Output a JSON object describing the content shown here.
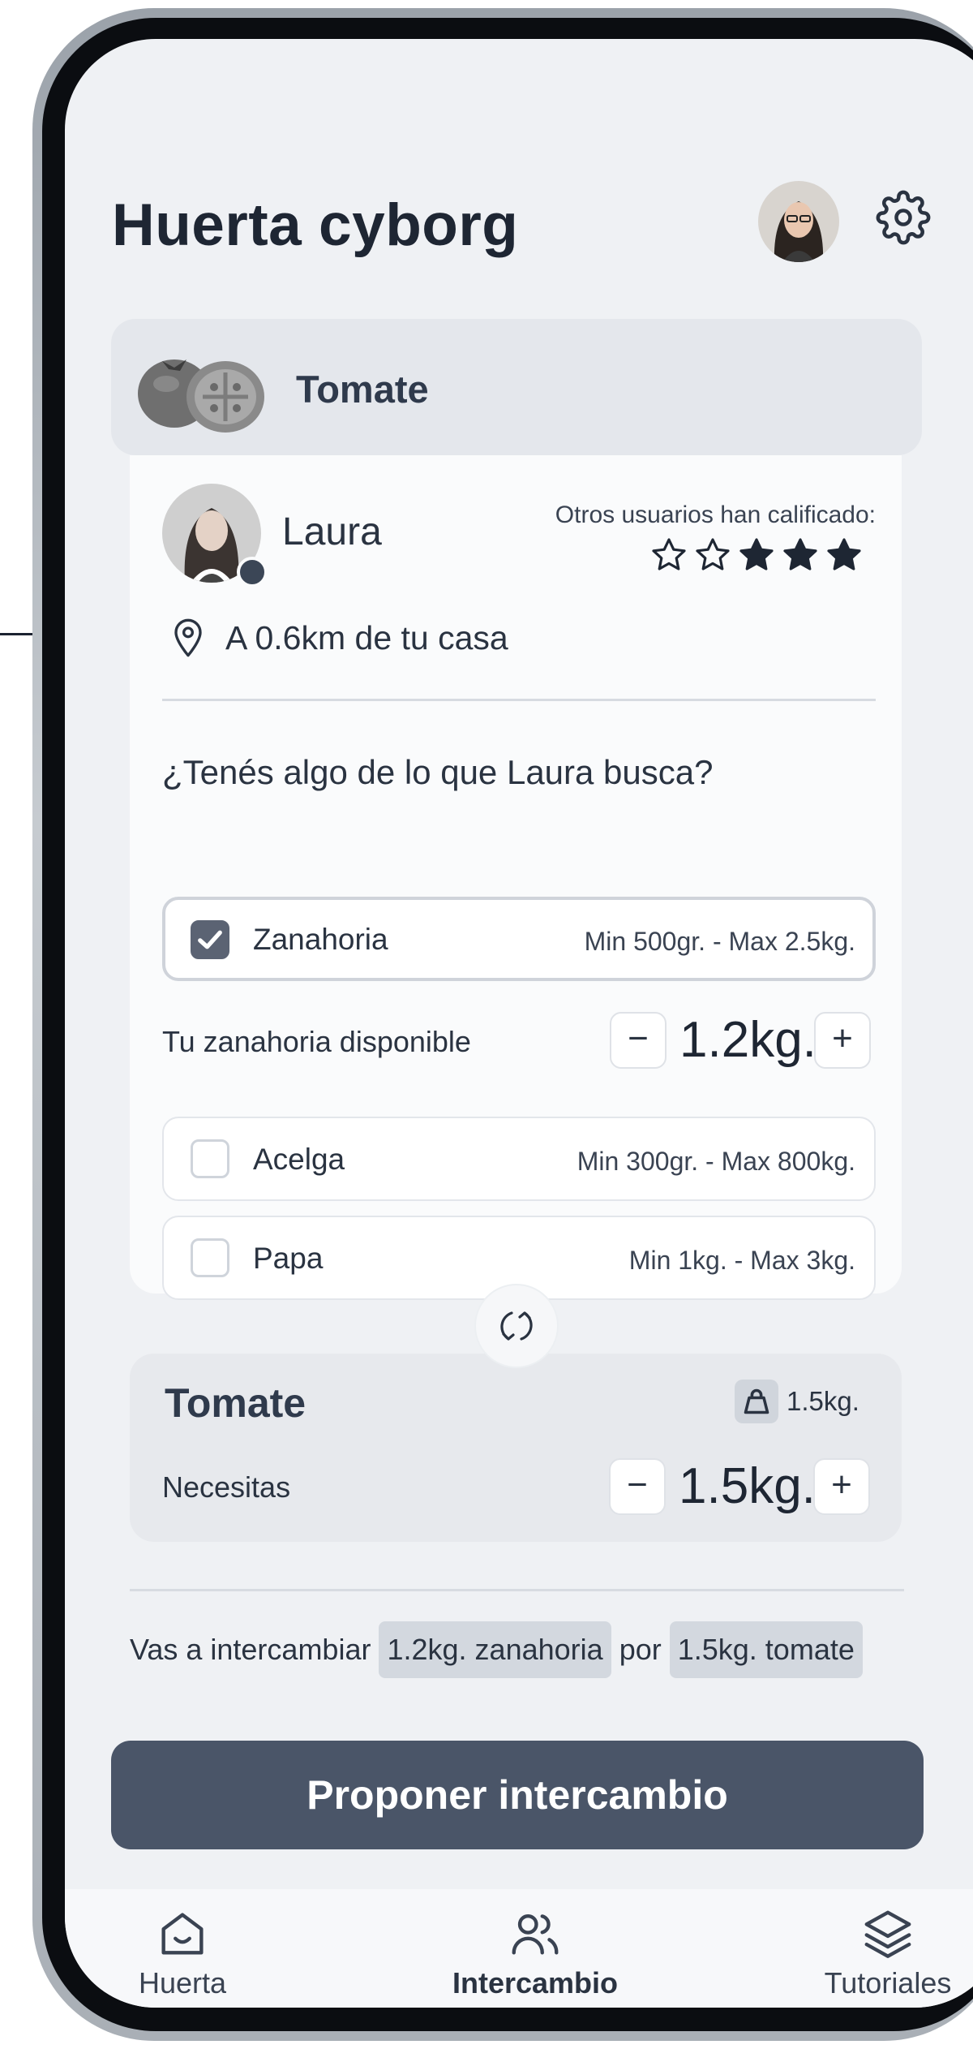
{
  "app": {
    "title": "Huerta cyborg"
  },
  "product": {
    "name": "Tomate"
  },
  "seller": {
    "name": "Laura",
    "rating_label": "Otros usuarios han calificado:",
    "rating": 3,
    "rating_max": 5,
    "location": "A 0.6km de tu casa"
  },
  "offer": {
    "question": "¿Tenés algo de lo que Laura busca?",
    "options": [
      {
        "name": "Zanahoria",
        "range": "Min 500gr. - Max 2.5kg.",
        "checked": true
      },
      {
        "name": "Acelga",
        "range": "Min 300gr. - Max 800kg.",
        "checked": false
      },
      {
        "name": "Papa",
        "range": "Min 1kg. - Max 3kg.",
        "checked": false
      }
    ],
    "available_label": "Tu zanahoria disponible",
    "available_qty": "1.2kg.",
    "minus": "−",
    "plus": "+"
  },
  "need": {
    "title": "Tomate",
    "stock": "1.5kg.",
    "label": "Necesitas",
    "qty": "1.5kg."
  },
  "summary": {
    "prefix": "Vas a intercambiar",
    "give": "1.2kg. zanahoria",
    "connector": "por",
    "get": "1.5kg. tomate"
  },
  "cta": {
    "label": "Proponer intercambio"
  },
  "tabs": [
    {
      "label": "Huerta",
      "icon": "home-icon",
      "active": false
    },
    {
      "label": "Intercambio",
      "icon": "users-icon",
      "active": true
    },
    {
      "label": "Tutoriales",
      "icon": "layers-icon",
      "active": false
    }
  ],
  "colors": {
    "primary": "#4a5568",
    "screen_bg": "#eff1f4",
    "card_bg": "#fafbfc",
    "checkbox_on": "#5b6373"
  }
}
